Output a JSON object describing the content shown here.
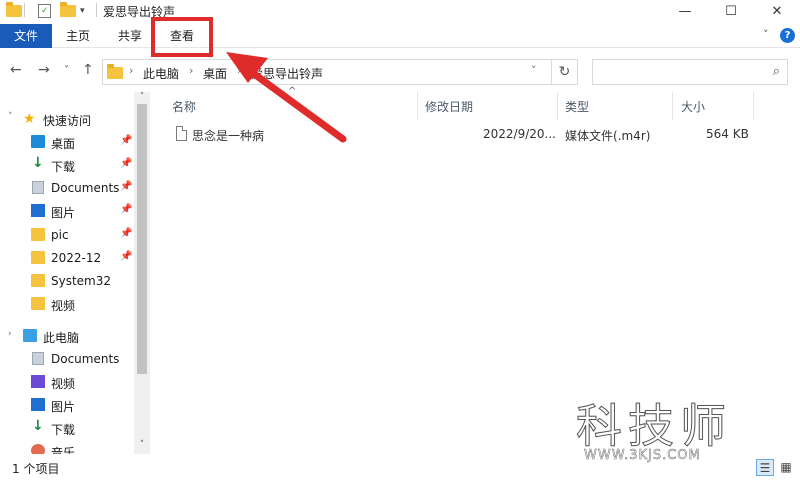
{
  "window": {
    "title": "爱思导出铃声",
    "minimize_glyph": "—",
    "maximize_glyph": "☐",
    "close_glyph": "✕"
  },
  "ribbon": {
    "tabs": [
      "文件",
      "主页",
      "共享",
      "查看"
    ],
    "expand_glyph": "˅",
    "help_glyph": "?"
  },
  "address": {
    "back_glyph": "←",
    "forward_glyph": "→",
    "recent_glyph": "˅",
    "up_glyph": "↑",
    "crumbs": [
      "此电脑",
      "桌面",
      "爱思导出铃声"
    ],
    "sep_glyph": "›",
    "dropdown_glyph": "˅",
    "refresh_glyph": "↻",
    "search_placeholder": "",
    "search_glyph": "⌕"
  },
  "sidebar": {
    "quick_access_label": "快速访问",
    "pin_glyph": "📌",
    "items": [
      {
        "label": "桌面",
        "icon": "desktop-icon",
        "pinned": true
      },
      {
        "label": "下载",
        "icon": "download-icon",
        "pinned": true
      },
      {
        "label": "Documents",
        "icon": "documents-icon",
        "pinned": true
      },
      {
        "label": "图片",
        "icon": "pictures-icon",
        "pinned": true
      },
      {
        "label": "pic",
        "icon": "folder-icon",
        "pinned": true
      },
      {
        "label": "2022-12",
        "icon": "folder-icon",
        "pinned": true
      },
      {
        "label": "System32",
        "icon": "folder-icon",
        "pinned": false
      },
      {
        "label": "视频",
        "icon": "folder-icon",
        "pinned": false
      }
    ],
    "this_pc_label": "此电脑",
    "pc_items": [
      {
        "label": "Documents",
        "icon": "documents-icon"
      },
      {
        "label": "视频",
        "icon": "videos-icon"
      },
      {
        "label": "图片",
        "icon": "pictures-icon"
      },
      {
        "label": "下载",
        "icon": "download-icon"
      },
      {
        "label": "音乐",
        "icon": "music-icon"
      }
    ],
    "expander_glyph": "›",
    "scroll_up_glyph": "˄",
    "scroll_down_glyph": "˅"
  },
  "columns": {
    "name": "名称",
    "date": "修改日期",
    "type": "类型",
    "size": "大小",
    "sort_glyph": "^"
  },
  "files": [
    {
      "name": "思念是一种病",
      "date": "2022/9/20...",
      "type": "媒体文件(.m4r)",
      "size": "564 KB"
    }
  ],
  "status": {
    "count_text": "1 个项目",
    "details_view_glyph": "☰",
    "tiles_view_glyph": "▦"
  },
  "watermark": {
    "chars": "科技师",
    "url": "WWW.3KJS.COM"
  },
  "colors": {
    "accent": "#1a5ab8",
    "annotation_red": "#e02b2b"
  }
}
